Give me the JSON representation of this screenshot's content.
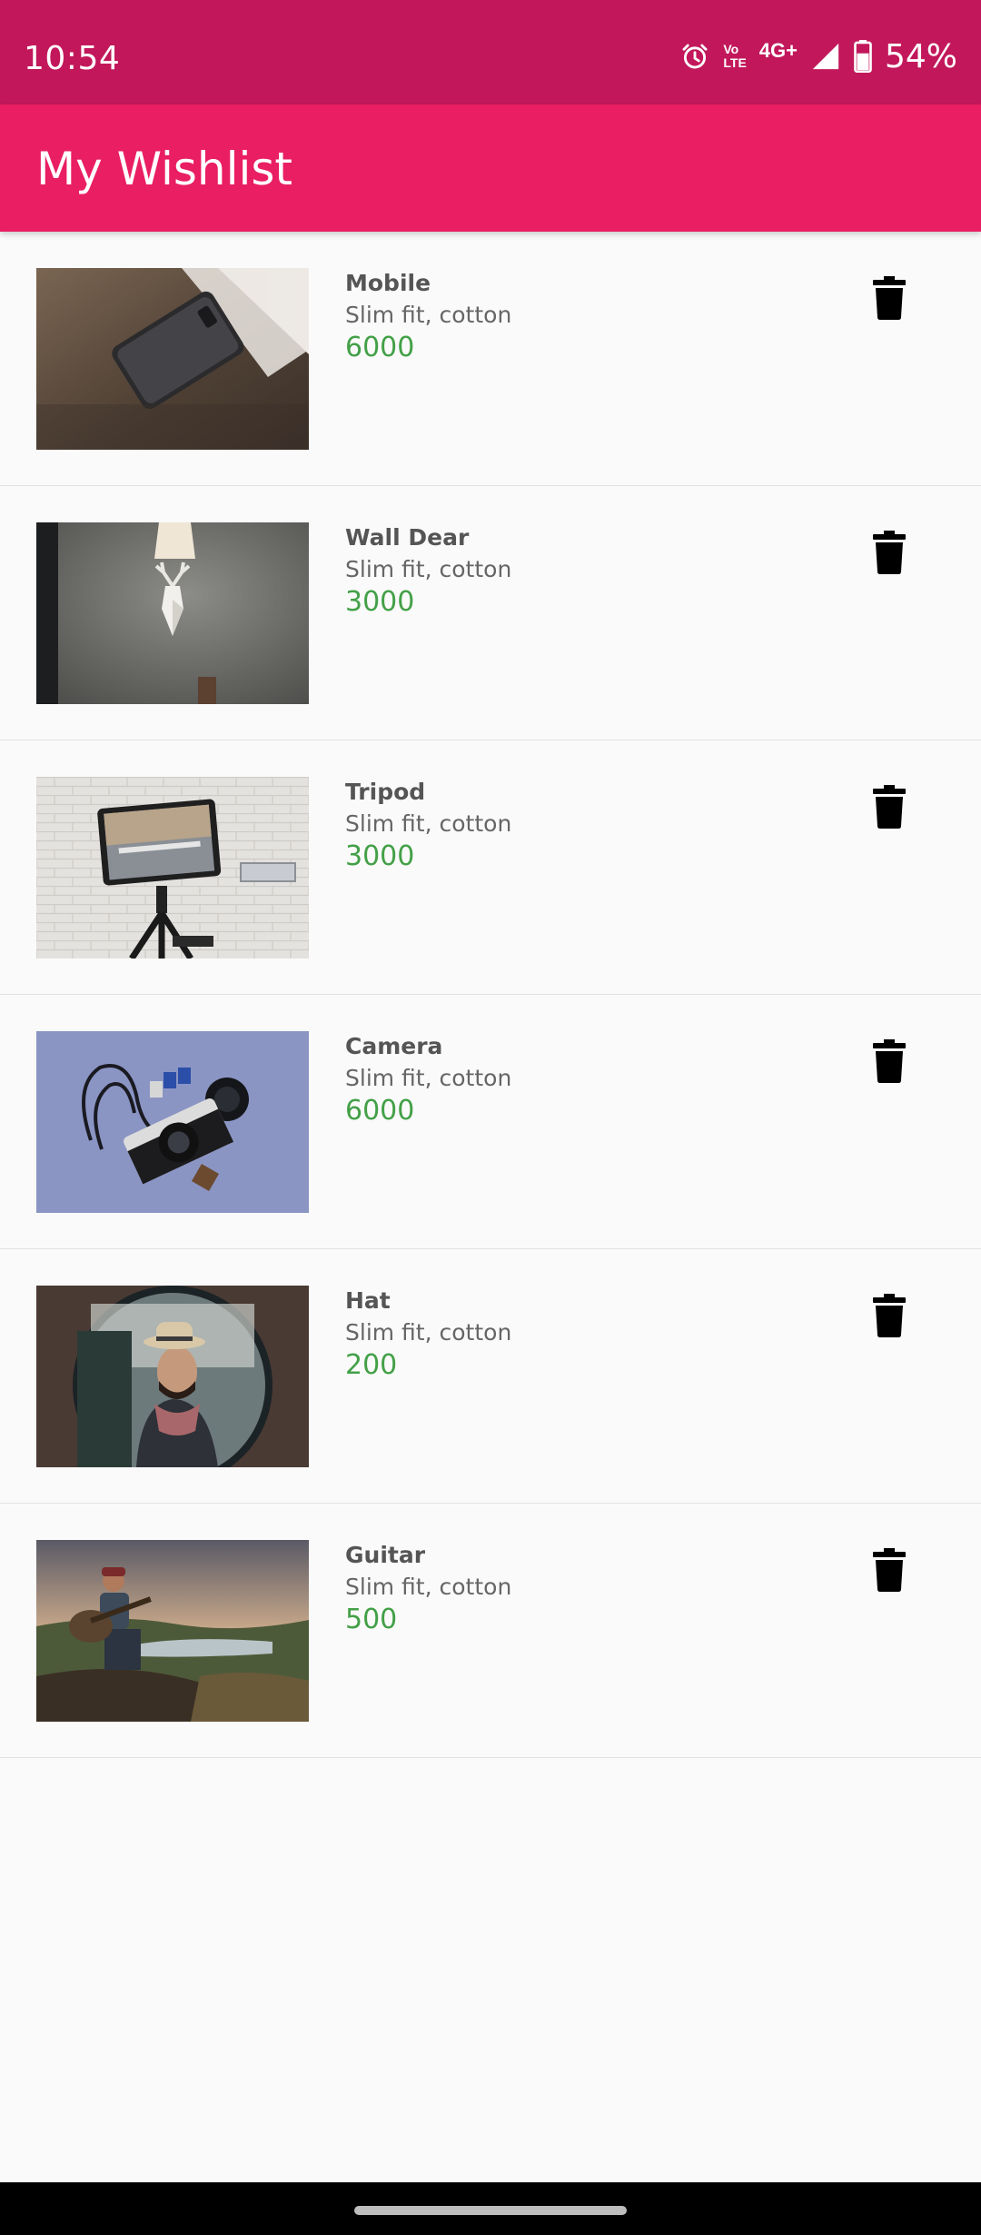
{
  "status_bar": {
    "time": "10:54",
    "volte_top": "Vo",
    "volte_bottom": "LTE",
    "network": "4G+",
    "battery": "54%",
    "icons": [
      "alarm-icon",
      "volte-icon",
      "signal-icon",
      "battery-icon"
    ],
    "background": "#c2185b"
  },
  "app_bar": {
    "title": "My Wishlist",
    "background": "#e91e63"
  },
  "items": [
    {
      "name": "Mobile",
      "description": "Slim fit, cotton",
      "price": "6000",
      "image": "phone-on-table-photo"
    },
    {
      "name": "Wall Dear",
      "description": "Slim fit, cotton",
      "price": "3000",
      "image": "deer-head-lamp-photo"
    },
    {
      "name": "Tripod",
      "description": "Slim fit, cotton",
      "price": "3000",
      "image": "tablet-on-tripod-photo"
    },
    {
      "name": "Camera",
      "description": "Slim fit, cotton",
      "price": "6000",
      "image": "camera-flatlay-photo"
    },
    {
      "name": "Hat",
      "description": "Slim fit, cotton",
      "price": "200",
      "image": "man-in-hat-photo"
    },
    {
      "name": "Guitar",
      "description": "Slim fit, cotton",
      "price": "500",
      "image": "guitarist-landscape-photo"
    }
  ],
  "colors": {
    "price": "#43a047",
    "name": "#555555",
    "description": "#666666",
    "delete_icon": "#000000"
  },
  "delete_icon": "trash-icon"
}
